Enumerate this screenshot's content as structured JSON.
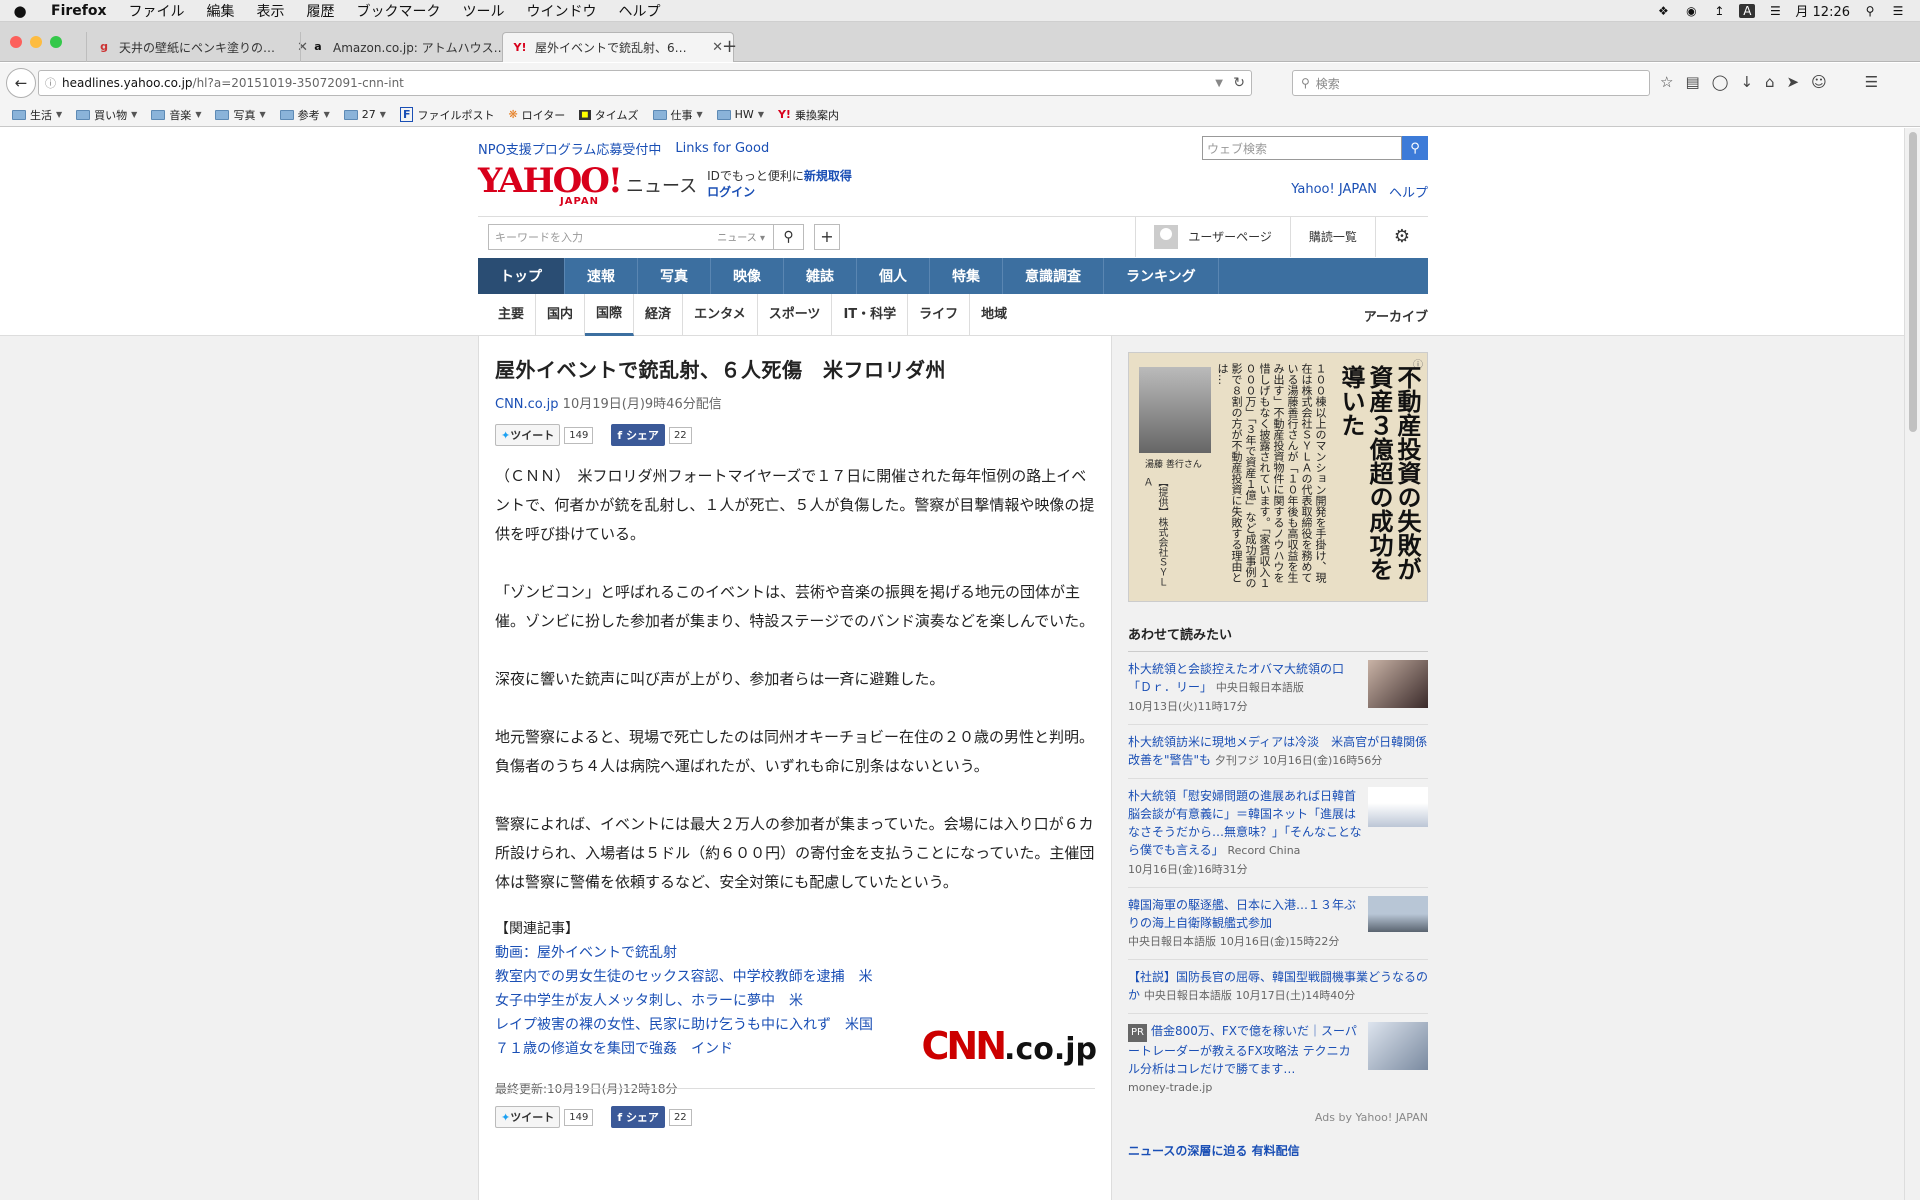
{
  "menubar": {
    "apple": "",
    "app": "Firefox",
    "items": [
      "ファイル",
      "編集",
      "表示",
      "履歴",
      "ブックマーク",
      "ツール",
      "ウインドウ",
      "ヘルプ"
    ],
    "clock": "月 12:26"
  },
  "tabs": [
    {
      "title": "天井の壁紙にペンキ塗りの…",
      "favicon": "g"
    },
    {
      "title": "Amazon.co.jp: アトムハウス…",
      "favicon": "a"
    },
    {
      "title": "屋外イベントで銃乱射、6…",
      "favicon": "Y!"
    }
  ],
  "url": {
    "scheme": "",
    "host": "headlines.yahoo.co.jp",
    "path": "/hl?a=20151019-35072091-cnn-int"
  },
  "browser_search_placeholder": "検索",
  "bookmarks": [
    {
      "label": "生活",
      "folder": true
    },
    {
      "label": "買い物",
      "folder": true
    },
    {
      "label": "音楽",
      "folder": true
    },
    {
      "label": "写真",
      "folder": true
    },
    {
      "label": "参考",
      "folder": true
    },
    {
      "label": "27",
      "folder": true
    },
    {
      "label": "ファイルポスト",
      "folder": false
    },
    {
      "label": "ロイター",
      "folder": false
    },
    {
      "label": "タイムズ",
      "folder": false
    },
    {
      "label": "仕事",
      "folder": true
    },
    {
      "label": "HW",
      "folder": true
    },
    {
      "label": "乗換案内",
      "folder": false
    }
  ],
  "promo": {
    "link1": "NPO支援プログラム応募受付中",
    "link2": "Links for Good",
    "websearch_placeholder": "ウェブ検索"
  },
  "header": {
    "logo": "YAHOO!",
    "logo_sub": "JAPAN",
    "section": "ニュース",
    "id_text": "IDでもっと便利に",
    "id_register": "新規取得",
    "login": "ログイン",
    "yahoo_japan": "Yahoo! JAPAN",
    "help": "ヘルプ"
  },
  "toolbar": {
    "keyword_placeholder": "キーワードを入力",
    "scope": "ニュース",
    "user_page": "ユーザーページ",
    "subscriptions": "購読一覧"
  },
  "gnav": [
    "トップ",
    "速報",
    "写真",
    "映像",
    "雑誌",
    "個人",
    "特集",
    "意識調査",
    "ランキング"
  ],
  "snav": [
    "主要",
    "国内",
    "国際",
    "経済",
    "エンタメ",
    "スポーツ",
    "IT・科学",
    "ライフ",
    "地域"
  ],
  "archive": "アーカイブ",
  "article": {
    "title": "屋外イベントで銃乱射、６人死傷　米フロリダ州",
    "source": "CNN.co.jp",
    "date": "10月19日(月)9時46分配信",
    "tweet": "ツイート",
    "tweet_count": "149",
    "share": "シェア",
    "share_count": "22",
    "paragraphs": [
      "（ＣＮＮ）　米フロリダ州フォートマイヤーズで１７日に開催された毎年恒例の路上イベントで、何者かが銃を乱射し、１人が死亡、５人が負傷した。警察が目撃情報や映像の提供を呼び掛けている。",
      "「ゾンビコン」と呼ばれるこのイベントは、芸術や音楽の振興を掲げる地元の団体が主催。ゾンビに扮した参加者が集まり、特設ステージでのバンド演奏などを楽しんでいた。",
      "深夜に響いた銃声に叫び声が上がり、参加者らは一斉に避難した。",
      "地元警察によると、現場で死亡したのは同州オキーチョビー在住の２０歳の男性と判明。負傷者のうち４人は病院へ運ばれたが、いずれも命に別条はないという。",
      "警察によれば、イベントには最大２万人の参加者が集まっていた。会場には入り口が６カ所設けられ、入場者は５ドル（約６００円）の寄付金を支払うことになっていた。主催団体は警察に警備を依頼するなど、安全対策にも配慮していたという。"
    ],
    "related_heading": "【関連記事】",
    "related": [
      "動画：屋外イベントで銃乱射",
      "教室内での男女生徒のセックス容認、中学校教師を逮捕　米",
      "女子中学生が友人メッタ刺し、ホラーに夢中　米",
      "レイプ被害の裸の女性、民家に助け乞うも中に入れず　米国",
      "７１歳の修道女を集団で強姦　インド"
    ],
    "updated": "最終更新:10月19日(月)12時18分",
    "cnn_logo": "CNN",
    "cnn_suffix": ".co.jp"
  },
  "ad": {
    "headline": "不動産投資の失敗が資産３億超の成功を導いた",
    "body": "１００棟以上のマンション開発を手掛け、現在は株式会社ＳＹＬＡの代表取締役を務めている湯藤善行さんが「１０年後も高収益を生み出す」不動産投資物件に関するノウハウを惜しげもなく披露されています。「家賃収入１０００万」「３年で資産１億」など成功事例の影で８割の方が不動産投資に失敗する理由とは…",
    "name": "湯藤 善行さん",
    "credit": "【提供】株式会社ＳＹＬＡ",
    "info": "ⓘ"
  },
  "sidebar": {
    "heading": "あわせて読みたい",
    "items": [
      {
        "title": "朴大統領と会談控えたオバマ大統領の口「Ｄｒ．リー」",
        "source": "中央日報日本語版",
        "date": "10月13日(火)11時17分"
      },
      {
        "title": "朴大統領訪米に現地メディアは冷淡　米高官が日韓関係改善を\"警告\"も",
        "source": "夕刊フジ",
        "date": "10月16日(金)16時56分"
      },
      {
        "title": "朴大統領「慰安婦問題の進展あれば日韓首脳会談が有意義に」＝韓国ネット「進展はなさそうだから…無意味？」「そんなことなら僕でも言える」",
        "source": "Record China",
        "date": "10月16日(金)16時31分"
      },
      {
        "title": "韓国海軍の駆逐艦、日本に入港…１３年ぶりの海上自衛隊観艦式参加",
        "source": "中央日報日本語版",
        "date": "10月16日(金)15時22分"
      },
      {
        "title": "【社説】国防長官の屈辱、韓国型戦闘機事業どうなるのか",
        "source": "中央日報日本語版",
        "date": "10月17日(土)14時40分"
      }
    ],
    "pr": {
      "badge": "PR",
      "title": "借金800万、FXで億を稼いだ｜スーパートレーダーが教えるFX攻略法 テクニカル分析はコレだけで勝てます…",
      "source": "money-trade.jp"
    },
    "ads_by": "Ads by Yahoo! JAPAN",
    "more": "ニュースの深層に迫る 有料配信"
  }
}
